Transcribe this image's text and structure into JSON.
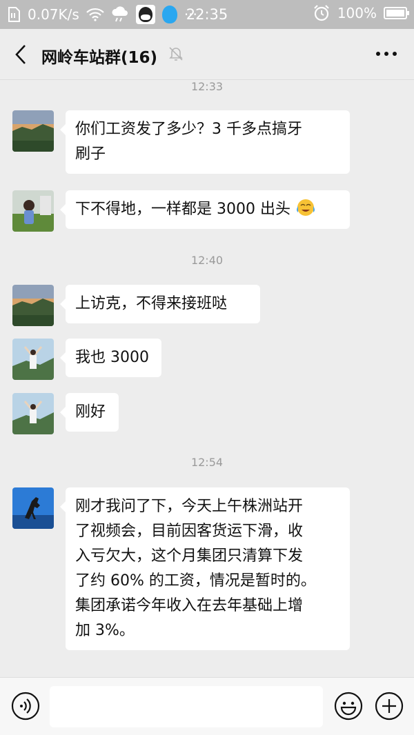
{
  "status_bar": {
    "network_speed": "0.07K/s",
    "time": "22:35",
    "battery": "100%"
  },
  "header": {
    "title": "网岭车站群(16)",
    "back_icon": "chevron-left-icon",
    "mute_icon": "bell-off-icon",
    "more_icon": "more-dots-icon"
  },
  "chat": {
    "timestamps": [
      "12:33",
      "12:40",
      "12:54"
    ],
    "messages": [
      {
        "avatar": "landscape-avatar",
        "lines": [
          "你们工资发了多少？3 千多点搞牙",
          "刷子"
        ]
      },
      {
        "avatar": "child-avatar",
        "lines": [
          "下不得地，一样都是 3000 出头"
        ],
        "emoji": "crying-laughing-emoji"
      },
      {
        "avatar": "landscape-avatar",
        "lines": [
          "上访克，不得来接班哒"
        ]
      },
      {
        "avatar": "arms-up-avatar",
        "lines": [
          "我也 3000"
        ]
      },
      {
        "avatar": "arms-up-avatar",
        "lines": [
          "刚好"
        ]
      },
      {
        "avatar": "horse-avatar",
        "lines": [
          "刚才我问了下，今天上午株洲站开",
          "了视频会，目前因客货运下滑，收",
          "入亏欠大，这个月集团只清算下发",
          "了约 60% 的工资，情况是暂时的。",
          "集团承诺今年收入在去年基础上增",
          "加 3%。"
        ]
      }
    ]
  },
  "input_bar": {
    "voice_icon": "voice-icon",
    "emoji_icon": "emoji-icon",
    "plus_icon": "plus-icon"
  }
}
